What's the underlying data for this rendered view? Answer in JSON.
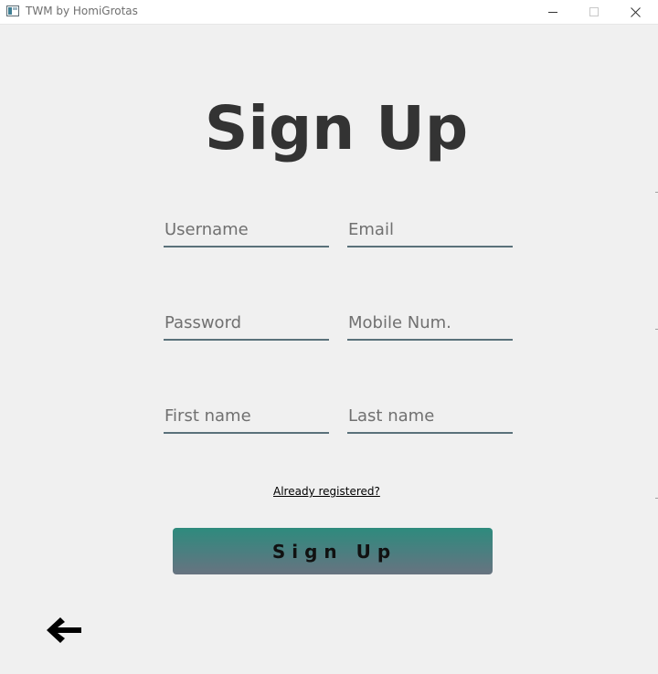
{
  "window": {
    "title": "TWM by HomiGrotas",
    "icons": {
      "app": "app-window-icon",
      "minimize": "minimize-icon",
      "maximize": "maximize-icon",
      "close": "close-icon"
    }
  },
  "form": {
    "heading": "Sign Up",
    "fields": {
      "username": {
        "placeholder": "Username",
        "value": ""
      },
      "email": {
        "placeholder": "Email",
        "value": ""
      },
      "password": {
        "placeholder": "Password",
        "value": ""
      },
      "mobile": {
        "placeholder": "Mobile Num.",
        "value": ""
      },
      "first_name": {
        "placeholder": "First name",
        "value": ""
      },
      "last_name": {
        "placeholder": "Last name",
        "value": ""
      }
    },
    "login_link": "Already registered?",
    "submit_label": "Sign Up",
    "back_icon": "arrow-left-icon"
  },
  "colors": {
    "background": "#f0f0f0",
    "heading": "#333333",
    "field_underline": "#5a717a",
    "button_gradient_top": "#2e8b7d",
    "button_gradient_bottom": "#687380"
  }
}
